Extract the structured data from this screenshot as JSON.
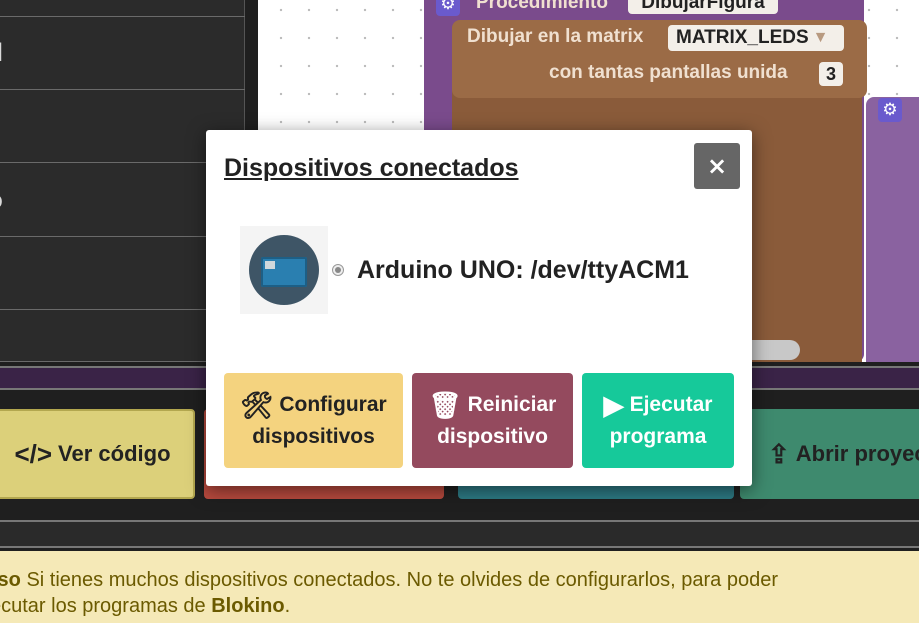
{
  "sidebar": {
    "items": [
      {
        "label": ""
      },
      {
        "label": "ad"
      },
      {
        "label": ""
      },
      {
        "label": "to"
      },
      {
        "label": "s"
      },
      {
        "label": ""
      }
    ]
  },
  "workspace": {
    "procedure_label": "Procedimiento",
    "procedure_name": "DibujarFigura",
    "draw_label": "Dibujar en la matrix",
    "matrix_field": "MATRIX_LEDS",
    "screens_label": "con tantas pantallas unida",
    "screens_value": "3"
  },
  "toolbar": {
    "view_code_label": "Ver código",
    "open_project_label": "Abrir proyect"
  },
  "notice": {
    "line1_prefix": "iso",
    "line1_text": " Si tienes muchos dispositivos conectados. No te olvides de configurarlos, para poder",
    "line2_text": "ecutar los programas de ",
    "line2_brand": "Blokino",
    "line2_end": "."
  },
  "modal": {
    "title": "Dispositivos conectados",
    "close_symbol": "×",
    "device_label": "Arduino UNO: /dev/ttyACM1",
    "buttons": {
      "configure_line1": "Configurar",
      "configure_line2": "dispositivos",
      "reset_line1": "Reiniciar",
      "reset_line2": "dispositivo",
      "run_line1": "Ejecutar",
      "run_line2": "programa"
    }
  },
  "colors": {
    "configure_bg": "#f4d37f",
    "reset_bg": "#944a5e",
    "run_bg": "#16c99a",
    "view_code_bg": "#dcd07a",
    "open_project_bg": "#3e8a6e"
  },
  "icons": {
    "configure": "tools-icon",
    "reset": "trash-restore-icon",
    "run": "play-circle-icon",
    "view_code": "code-icon",
    "open_project": "file-upload-icon",
    "close": "close-icon",
    "gear": "gear-icon"
  }
}
